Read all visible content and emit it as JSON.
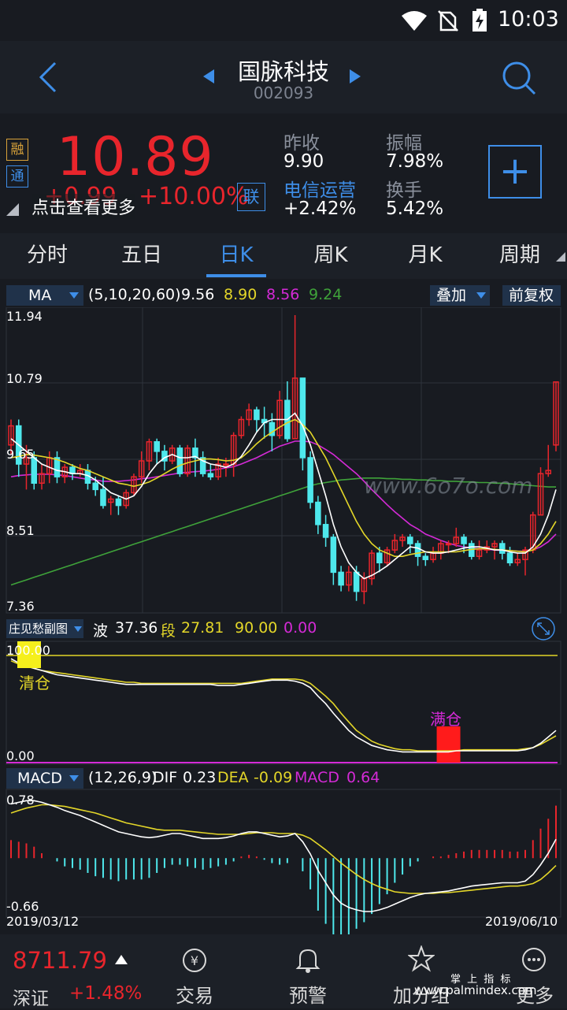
{
  "status": {
    "time": "10:03"
  },
  "header": {
    "title": "国脉科技",
    "code": "002093"
  },
  "quote": {
    "price": "10.89",
    "change": "+0.99",
    "change_pct": "+10.00%",
    "badge_rong": "融",
    "badge_tong": "通",
    "badge_lian": "联",
    "more_link": "点击查看更多",
    "prev_close_label": "昨收",
    "prev_close": "9.90",
    "amplitude_label": "振幅",
    "amplitude": "7.98%",
    "sector_label": "电信运营",
    "sector_change": "+2.42%",
    "turnover_label": "换手",
    "turnover": "5.42%",
    "add_button": "+"
  },
  "tabs": [
    "分时",
    "五日",
    "日K",
    "周K",
    "月K",
    "周期"
  ],
  "active_tab": "日K",
  "ma_bar": {
    "dropdown": "MA",
    "params": "(5,10,20,60)",
    "ma5": "9.56",
    "ma10": "8.90",
    "ma20": "8.56",
    "ma60": "9.24",
    "overlay": "叠加",
    "adjust": "前复权"
  },
  "price_axis": [
    "11.94",
    "10.79",
    "9.65",
    "8.51",
    "7.36"
  ],
  "watermark": "www.6o7o.com",
  "sub_bar": {
    "dropdown": "庄见愁副图",
    "bo_label": "波",
    "bo": "37.36",
    "duan_label": "段",
    "duan": "27.81",
    "v3": "90.00",
    "v4": "0.00"
  },
  "sub_axis": {
    "top": "100.00",
    "bottom": "0.00"
  },
  "sub_labels": {
    "clear": "清仓",
    "full": "满仓"
  },
  "macd_bar": {
    "dropdown": "MACD",
    "params": "(12,26,9)",
    "dif_label": "DIF",
    "dif": "0.23",
    "dea_label": "DEA",
    "dea": "-0.09",
    "macd_label": "MACD",
    "macd": "0.64"
  },
  "macd_axis": {
    "top": "0.78",
    "bottom": "-0.66"
  },
  "dates": {
    "start": "2019/03/12",
    "end": "2019/06/10"
  },
  "index": {
    "value": "8711.79",
    "name": "深证",
    "change": "+1.48%"
  },
  "bottom_nav": [
    "交易",
    "预警",
    "加分组",
    "更多"
  ],
  "footer_watermark": {
    "line1": "掌 上 指 标",
    "line2": "www.palmindex.com"
  },
  "colors": {
    "up": "#e8252c",
    "down": "#4ee8ec",
    "ma5": "#ffffff",
    "ma10": "#e3d629",
    "ma20": "#d42ad6",
    "ma60": "#3fa33a",
    "accent": "#3e8ee8"
  },
  "chart_data": {
    "type": "candlestick",
    "x_range": [
      "2019/03/12",
      "2019/06/10"
    ],
    "ylim": [
      7.36,
      11.94
    ],
    "candles": [
      [
        9.9,
        10.2,
        10.3,
        9.75
      ],
      [
        10.2,
        9.6,
        10.3,
        9.4
      ],
      [
        9.6,
        9.7,
        9.9,
        9.2
      ],
      [
        9.7,
        9.3,
        9.8,
        9.2
      ],
      [
        9.3,
        9.45,
        9.6,
        9.2
      ],
      [
        9.45,
        9.7,
        9.8,
        9.3
      ],
      [
        9.7,
        9.4,
        9.8,
        9.3
      ],
      [
        9.4,
        9.55,
        9.6,
        9.3
      ],
      [
        9.55,
        9.45,
        9.6,
        9.35
      ],
      [
        9.45,
        9.5,
        9.6,
        9.4
      ],
      [
        9.5,
        9.3,
        9.6,
        9.2
      ],
      [
        9.3,
        9.2,
        9.4,
        9.1
      ],
      [
        9.2,
        8.95,
        9.4,
        8.9
      ],
      [
        9.0,
        9.05,
        9.1,
        8.8
      ],
      [
        9.05,
        8.95,
        9.1,
        8.8
      ],
      [
        8.95,
        9.15,
        9.2,
        8.9
      ],
      [
        9.15,
        9.4,
        9.45,
        9.1
      ],
      [
        9.4,
        9.65,
        9.8,
        9.3
      ],
      [
        9.65,
        9.95,
        10.0,
        9.5
      ],
      [
        9.95,
        9.8,
        10.0,
        9.6
      ],
      [
        9.8,
        9.65,
        9.9,
        9.5
      ],
      [
        9.65,
        9.85,
        9.9,
        9.6
      ],
      [
        9.85,
        9.45,
        9.9,
        9.4
      ],
      [
        9.45,
        9.85,
        9.9,
        9.4
      ],
      [
        9.85,
        9.7,
        10.0,
        9.4
      ],
      [
        9.7,
        9.45,
        9.8,
        9.4
      ],
      [
        9.45,
        9.4,
        9.6,
        9.35
      ],
      [
        9.4,
        9.6,
        9.7,
        9.35
      ],
      [
        9.6,
        9.6,
        9.7,
        9.4
      ],
      [
        9.6,
        10.05,
        10.1,
        9.4
      ],
      [
        10.05,
        10.3,
        10.35,
        10.0
      ],
      [
        10.3,
        10.45,
        10.55,
        10.2
      ],
      [
        10.45,
        10.3,
        10.5,
        10.1
      ],
      [
        10.3,
        10.25,
        10.5,
        10.0
      ],
      [
        10.25,
        10.05,
        10.4,
        9.8
      ],
      [
        10.05,
        10.6,
        10.75,
        10.0
      ],
      [
        10.6,
        10.0,
        10.9,
        9.95
      ],
      [
        10.0,
        10.95,
        11.94,
        10.0
      ],
      [
        10.95,
        9.7,
        10.9,
        9.5
      ],
      [
        9.7,
        9.0,
        9.8,
        8.9
      ],
      [
        9.0,
        8.65,
        9.1,
        8.5
      ],
      [
        8.65,
        8.45,
        8.8,
        8.3
      ],
      [
        8.45,
        7.9,
        8.5,
        7.7
      ],
      [
        7.9,
        7.7,
        8.0,
        7.6
      ],
      [
        7.7,
        7.9,
        8.0,
        7.6
      ],
      [
        7.9,
        7.6,
        8.0,
        7.45
      ],
      [
        7.6,
        7.8,
        7.9,
        7.4
      ],
      [
        7.8,
        8.2,
        8.25,
        7.7
      ],
      [
        8.2,
        8.05,
        8.3,
        7.9
      ],
      [
        8.05,
        8.25,
        8.3,
        8.0
      ],
      [
        8.25,
        8.4,
        8.5,
        8.2
      ],
      [
        8.4,
        8.45,
        8.5,
        8.3
      ],
      [
        8.45,
        8.35,
        8.5,
        8.2
      ],
      [
        8.35,
        8.15,
        8.4,
        8.0
      ],
      [
        8.15,
        8.1,
        8.2,
        8.0
      ],
      [
        8.1,
        8.2,
        8.3,
        8.05
      ],
      [
        8.2,
        8.35,
        8.4,
        8.1
      ],
      [
        8.35,
        8.35,
        8.4,
        8.2
      ],
      [
        8.35,
        8.45,
        8.6,
        8.3
      ],
      [
        8.45,
        8.35,
        8.5,
        8.2
      ],
      [
        8.35,
        8.15,
        8.4,
        8.1
      ],
      [
        8.15,
        8.25,
        8.4,
        8.1
      ],
      [
        8.25,
        8.3,
        8.4,
        8.2
      ],
      [
        8.3,
        8.35,
        8.4,
        8.1
      ],
      [
        8.35,
        8.2,
        8.4,
        8.1
      ],
      [
        8.2,
        8.05,
        8.3,
        8.0
      ],
      [
        8.05,
        8.1,
        8.2,
        8.0
      ],
      [
        8.1,
        8.25,
        8.3,
        7.85
      ],
      [
        8.25,
        8.8,
        8.85,
        8.2
      ],
      [
        8.8,
        9.45,
        9.55,
        8.8
      ],
      [
        9.45,
        9.5,
        9.9,
        9.4
      ],
      [
        9.9,
        10.89,
        10.89,
        9.8
      ]
    ],
    "series": [
      {
        "name": "MA5",
        "values": [
          10.0,
          9.9,
          9.8,
          9.7,
          9.6,
          9.55,
          9.5,
          9.48,
          9.45,
          9.45,
          9.42,
          9.35,
          9.25,
          9.15,
          9.1,
          9.05,
          9.1,
          9.25,
          9.45,
          9.6,
          9.7,
          9.75,
          9.7,
          9.7,
          9.72,
          9.65,
          9.6,
          9.58,
          9.55,
          9.6,
          9.72,
          9.9,
          10.1,
          10.25,
          10.3,
          10.3,
          10.3,
          10.4,
          10.2,
          9.9,
          9.5,
          9.1,
          8.65,
          8.3,
          8.05,
          7.9,
          7.8,
          7.85,
          7.92,
          8.0,
          8.1,
          8.2,
          8.3,
          8.28,
          8.22,
          8.2,
          8.2,
          8.22,
          8.25,
          8.28,
          8.3,
          8.3,
          8.28,
          8.25,
          8.25,
          8.22,
          8.2,
          8.2,
          8.3,
          8.5,
          8.8,
          9.2
        ]
      },
      {
        "name": "MA10",
        "values": [
          9.7,
          9.72,
          9.75,
          9.74,
          9.72,
          9.7,
          9.67,
          9.63,
          9.58,
          9.53,
          9.5,
          9.45,
          9.4,
          9.35,
          9.3,
          9.28,
          9.25,
          9.28,
          9.32,
          9.38,
          9.45,
          9.52,
          9.58,
          9.62,
          9.65,
          9.68,
          9.68,
          9.67,
          9.65,
          9.66,
          9.7,
          9.8,
          9.92,
          10.02,
          10.1,
          10.18,
          10.25,
          10.3,
          10.22,
          10.1,
          9.9,
          9.7,
          9.45,
          9.2,
          8.95,
          8.7,
          8.5,
          8.35,
          8.25,
          8.2,
          8.15,
          8.15,
          8.18,
          8.2,
          8.22,
          8.22,
          8.22,
          8.22,
          8.22,
          8.24,
          8.26,
          8.27,
          8.27,
          8.26,
          8.25,
          8.24,
          8.23,
          8.22,
          8.25,
          8.35,
          8.5,
          8.7
        ]
      },
      {
        "name": "MA20",
        "values": [
          9.4,
          9.42,
          9.43,
          9.44,
          9.44,
          9.44,
          9.43,
          9.42,
          9.4,
          9.38,
          9.36,
          9.35,
          9.33,
          9.33,
          9.33,
          9.34,
          9.35,
          9.37,
          9.38,
          9.4,
          9.42,
          9.44,
          9.46,
          9.47,
          9.48,
          9.49,
          9.5,
          9.52,
          9.54,
          9.56,
          9.6,
          9.65,
          9.7,
          9.76,
          9.82,
          9.88,
          9.92,
          9.96,
          9.96,
          9.95,
          9.9,
          9.83,
          9.75,
          9.65,
          9.55,
          9.45,
          9.33,
          9.2,
          9.08,
          8.96,
          8.85,
          8.75,
          8.65,
          8.58,
          8.5,
          8.45,
          8.4,
          8.36,
          8.32,
          8.3,
          8.28,
          8.27,
          8.26,
          8.25,
          8.24,
          8.24,
          8.23,
          8.23,
          8.25,
          8.3,
          8.38,
          8.5
        ]
      },
      {
        "name": "MA60",
        "values": [
          7.7,
          7.74,
          7.78,
          7.82,
          7.86,
          7.9,
          7.94,
          7.98,
          8.02,
          8.06,
          8.1,
          8.14,
          8.18,
          8.22,
          8.26,
          8.3,
          8.34,
          8.38,
          8.42,
          8.46,
          8.5,
          8.54,
          8.58,
          8.62,
          8.66,
          8.7,
          8.74,
          8.78,
          8.82,
          8.86,
          8.9,
          8.94,
          8.98,
          9.02,
          9.06,
          9.1,
          9.14,
          9.18,
          9.22,
          9.26,
          9.29,
          9.31,
          9.33,
          9.35,
          9.36,
          9.37,
          9.38,
          9.38,
          9.38,
          9.37,
          9.37,
          9.36,
          9.36,
          9.35,
          9.35,
          9.34,
          9.34,
          9.33,
          9.33,
          9.32,
          9.32,
          9.31,
          9.31,
          9.3,
          9.3,
          9.29,
          9.28,
          9.27,
          9.26,
          9.25,
          9.24,
          9.24
        ]
      }
    ],
    "sub_chart": {
      "ylim": [
        0,
        100
      ],
      "white": [
        97,
        93,
        90,
        88,
        86,
        84,
        82,
        81,
        80,
        79,
        78,
        77,
        76,
        75,
        74,
        73,
        73,
        73,
        73,
        73,
        73,
        73,
        73,
        73,
        73,
        73,
        73,
        72,
        72,
        72,
        73,
        74,
        75,
        76,
        77,
        77,
        77,
        76,
        74,
        70,
        62,
        55,
        46,
        38,
        30,
        24,
        20,
        16,
        14,
        12,
        11,
        10,
        10,
        10,
        10,
        10,
        10,
        10,
        11,
        11,
        11,
        11,
        11,
        11,
        11,
        11,
        11,
        12,
        14,
        18,
        24,
        30
      ],
      "yellow": [
        95,
        92,
        90,
        88,
        86,
        85,
        84,
        83,
        82,
        81,
        80,
        79,
        78,
        77,
        76,
        75,
        75,
        74,
        74,
        74,
        74,
        74,
        74,
        74,
        74,
        74,
        74,
        74,
        74,
        74,
        74,
        75,
        76,
        77,
        78,
        78,
        78,
        78,
        77,
        74,
        68,
        62,
        55,
        46,
        38,
        30,
        25,
        20,
        17,
        15,
        13,
        12,
        12,
        11,
        11,
        11,
        11,
        11,
        11,
        12,
        12,
        12,
        12,
        12,
        12,
        12,
        12,
        13,
        14,
        17,
        21,
        25
      ],
      "full_marker_index": 57
    },
    "macd": {
      "ylim": [
        -0.66,
        0.78
      ],
      "dif": [
        0.66,
        0.68,
        0.7,
        0.7,
        0.68,
        0.65,
        0.62,
        0.58,
        0.55,
        0.52,
        0.48,
        0.44,
        0.4,
        0.36,
        0.32,
        0.3,
        0.28,
        0.26,
        0.25,
        0.26,
        0.28,
        0.3,
        0.3,
        0.28,
        0.26,
        0.24,
        0.24,
        0.24,
        0.25,
        0.27,
        0.3,
        0.32,
        0.32,
        0.3,
        0.28,
        0.26,
        0.27,
        0.3,
        0.2,
        0.05,
        -0.15,
        -0.3,
        -0.45,
        -0.55,
        -0.6,
        -0.63,
        -0.65,
        -0.65,
        -0.63,
        -0.6,
        -0.56,
        -0.52,
        -0.48,
        -0.45,
        -0.43,
        -0.42,
        -0.41,
        -0.4,
        -0.38,
        -0.36,
        -0.34,
        -0.33,
        -0.32,
        -0.31,
        -0.3,
        -0.3,
        -0.3,
        -0.28,
        -0.2,
        -0.08,
        0.06,
        0.23
      ],
      "dea": [
        0.55,
        0.58,
        0.61,
        0.63,
        0.65,
        0.65,
        0.64,
        0.63,
        0.61,
        0.59,
        0.57,
        0.55,
        0.52,
        0.49,
        0.46,
        0.43,
        0.41,
        0.39,
        0.37,
        0.35,
        0.34,
        0.34,
        0.34,
        0.33,
        0.32,
        0.31,
        0.3,
        0.29,
        0.29,
        0.29,
        0.29,
        0.3,
        0.31,
        0.31,
        0.31,
        0.3,
        0.3,
        0.3,
        0.28,
        0.24,
        0.17,
        0.1,
        0.02,
        -0.06,
        -0.13,
        -0.2,
        -0.26,
        -0.31,
        -0.35,
        -0.38,
        -0.41,
        -0.42,
        -0.43,
        -0.43,
        -0.43,
        -0.43,
        -0.42,
        -0.42,
        -0.41,
        -0.4,
        -0.39,
        -0.38,
        -0.37,
        -0.36,
        -0.35,
        -0.34,
        -0.34,
        -0.33,
        -0.31,
        -0.26,
        -0.18,
        -0.09
      ],
      "hist": [
        0.22,
        0.2,
        0.18,
        0.14,
        0.06,
        0.0,
        -0.04,
        -0.1,
        -0.12,
        -0.14,
        -0.18,
        -0.22,
        -0.24,
        -0.26,
        -0.28,
        -0.26,
        -0.26,
        -0.26,
        -0.24,
        -0.18,
        -0.12,
        -0.08,
        -0.08,
        -0.1,
        -0.12,
        -0.14,
        -0.12,
        -0.1,
        -0.08,
        -0.04,
        0.02,
        0.04,
        0.02,
        -0.02,
        -0.06,
        -0.08,
        -0.06,
        0.0,
        -0.16,
        -0.38,
        -0.64,
        -0.8,
        -0.94,
        -0.98,
        -0.94,
        -0.86,
        -0.78,
        -0.68,
        -0.56,
        -0.44,
        -0.3,
        -0.2,
        -0.1,
        -0.04,
        0.0,
        0.02,
        0.02,
        0.04,
        0.06,
        0.08,
        0.1,
        0.1,
        0.1,
        0.1,
        0.1,
        0.08,
        0.08,
        0.1,
        0.22,
        0.36,
        0.48,
        0.64
      ]
    }
  }
}
